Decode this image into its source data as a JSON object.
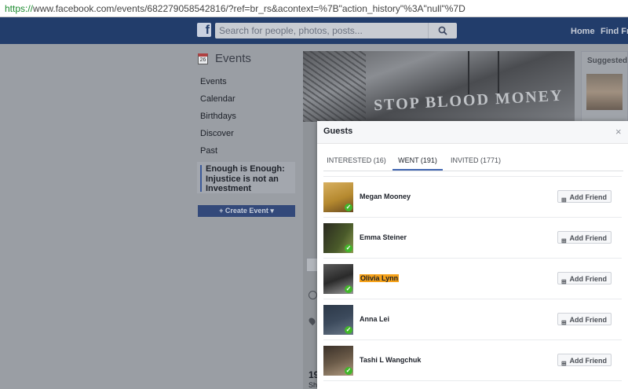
{
  "browser": {
    "url_scheme": "https://",
    "url_rest": "www.facebook.com/events/682279058542816/?ref=br_rs&acontext=%7B\"action_history\"%3A\"null\"%7D"
  },
  "topbar": {
    "logo": "f",
    "search_placeholder": "Search for people, photos, posts...",
    "home": "Home",
    "find_friends": "Find Fri"
  },
  "left_nav": {
    "title": "Events",
    "calendar_day": "26",
    "items": [
      "Events",
      "Calendar",
      "Birthdays",
      "Discover",
      "Past"
    ],
    "active_event": "Enough is Enough: Injustice is not an Investment",
    "create_event": "+ Create Event ▾"
  },
  "cover": {
    "sign_text": "STOP BLOOD MONEY"
  },
  "right_box": {
    "label": "Suggested E"
  },
  "under": {
    "count_fragment": "19",
    "sub_fragment": "Sh"
  },
  "dialog": {
    "title": "Guests",
    "close": "×",
    "tabs": [
      "INTERESTED (16)",
      "WENT (191)",
      "INVITED (1771)"
    ],
    "active_tab": 1,
    "add_friend_label": "Add Friend",
    "guests": [
      {
        "name": "Megan Mooney",
        "highlight": false,
        "avatar_color": "#b5892f"
      },
      {
        "name": "Emma Steiner",
        "highlight": false,
        "avatar_color": "#4a5a2a"
      },
      {
        "name": "Olivia Lynn",
        "highlight": true,
        "avatar_color": "#3a3a3a"
      },
      {
        "name": "Anna Lei",
        "highlight": false,
        "avatar_color": "#3c4a5c"
      },
      {
        "name": "Tashi L Wangchuk",
        "highlight": false,
        "avatar_color": "#6a5a48"
      }
    ]
  }
}
